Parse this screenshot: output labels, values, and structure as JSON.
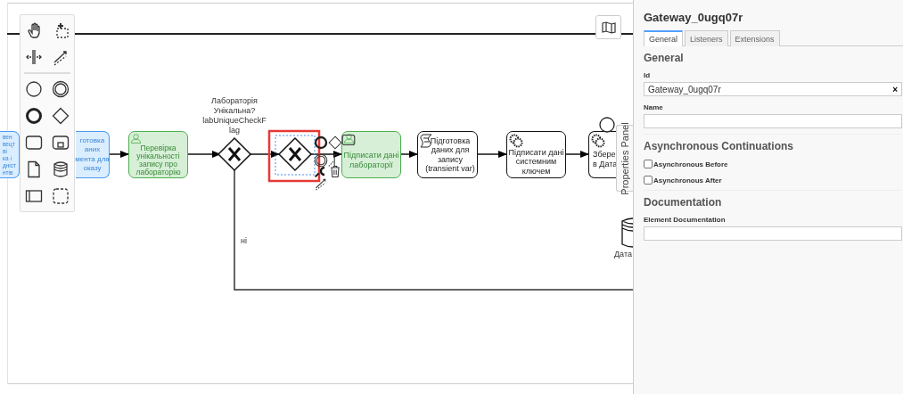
{
  "palette": {
    "tools": [
      {
        "kind": "hand"
      },
      {
        "kind": "lasso"
      },
      {
        "kind": "space"
      },
      {
        "kind": "connect"
      },
      {
        "kind": "separator"
      },
      {
        "kind": "start-event"
      },
      {
        "kind": "intermediate-event"
      },
      {
        "kind": "end-event"
      },
      {
        "kind": "gateway"
      },
      {
        "kind": "task"
      },
      {
        "kind": "subprocess"
      },
      {
        "kind": "data-object"
      },
      {
        "kind": "data-store"
      },
      {
        "kind": "pool"
      },
      {
        "kind": "group"
      }
    ]
  },
  "diagram": {
    "tasks": [
      {
        "kind": "plain",
        "color": "#dbeeff",
        "lines": [
          "вен",
          "вецт",
          "ві",
          "ка і",
          "дніст",
          "нтів"
        ]
      },
      {
        "kind": "plain",
        "color": "#dbeeff",
        "lines": [
          "готовка",
          "аних",
          "мента для",
          "оказу"
        ]
      },
      {
        "kind": "user",
        "color": "#d6efd6",
        "lines": [
          "Перевірка",
          "унікальності",
          "запису про",
          "лабораторію"
        ]
      },
      {
        "kind": "user",
        "color": "#d6efd6",
        "lines": [
          "Підписати дані",
          "лабораторії"
        ]
      },
      {
        "kind": "script",
        "color": "#ffffff",
        "lines": [
          "Підготовка",
          "даних для",
          "запису",
          "(transient var)"
        ]
      },
      {
        "kind": "service",
        "color": "#ffffff",
        "lines": [
          "Підписати дані",
          "системним",
          "ключем"
        ]
      },
      {
        "kind": "service",
        "color": "#ffffff",
        "lines": [
          "Збере",
          "в Дата"
        ]
      }
    ],
    "gateways": [
      {
        "lines": [
          "Лабораторія",
          "Унікальна?",
          "labUniqueCheckF",
          "lag"
        ],
        "selected": false
      },
      {
        "selected": true
      }
    ],
    "flow_label": "ні",
    "data_store_label": "Дата",
    "context_pad": [
      {
        "kind": "end-event"
      },
      {
        "kind": "gateway"
      },
      {
        "kind": "task"
      },
      {
        "kind": "intermediate-event"
      },
      {
        "kind": "annotation"
      },
      {
        "kind": "wrench"
      },
      {
        "kind": "trash"
      },
      {
        "kind": "connect"
      }
    ],
    "properties_tab": "Properties Panel"
  },
  "properties": {
    "title": "Gateway_0ugq07r",
    "tabs": [
      {
        "label": "General",
        "selected": true
      },
      {
        "label": "Listeners",
        "selected": false
      },
      {
        "label": "Extensions",
        "selected": false
      }
    ],
    "general": {
      "heading": "General",
      "id_label": "Id",
      "id_value": "Gateway_0ugq07r",
      "clear_symbol": "×",
      "name_label": "Name"
    },
    "async": {
      "heading": "Asynchronous Continuations",
      "options": [
        {
          "label": "Asynchronous Before",
          "checked": false
        },
        {
          "label": "Asynchronous After",
          "checked": false
        }
      ]
    },
    "documentation": {
      "heading": "Documentation",
      "label": "Element Documentation"
    }
  }
}
